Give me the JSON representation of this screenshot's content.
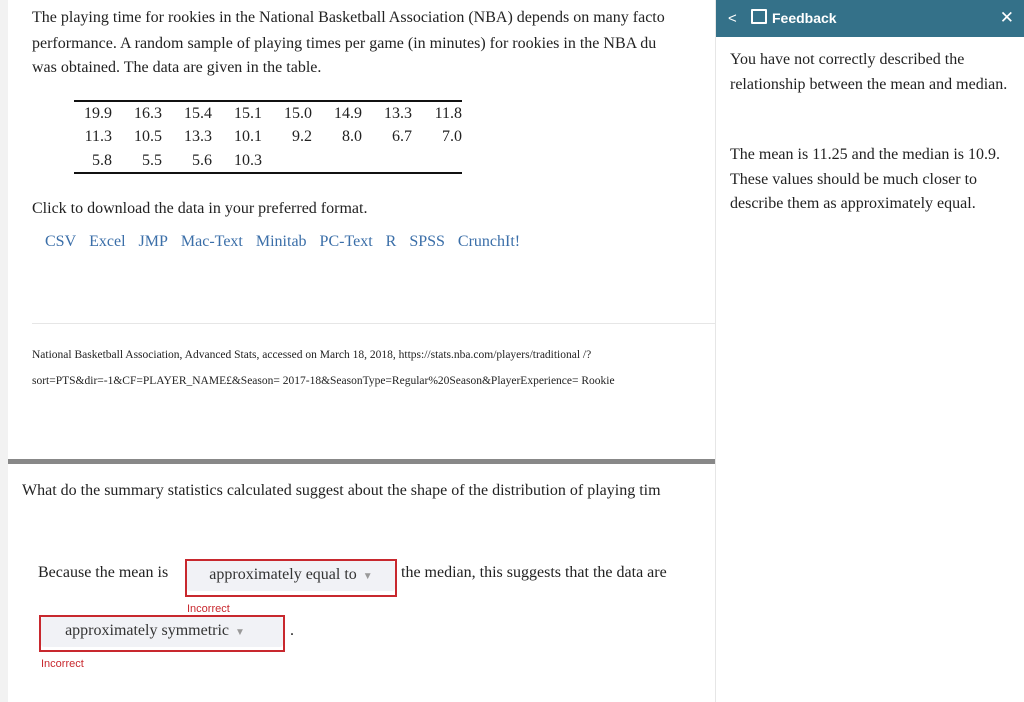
{
  "question": {
    "intro_lines": [
      "The playing time for rookies in the National Basketball Association (NBA) depends on many facto",
      "performance. A random sample of playing times per game (in minutes) for rookies in the NBA du",
      "was obtained. The data are given in the table."
    ],
    "table": [
      [
        "19.9",
        "16.3",
        "15.4",
        "15.1",
        "15.0",
        "14.9",
        "13.3",
        "11.8"
      ],
      [
        "11.3",
        "10.5",
        "13.3",
        "10.1",
        "9.2",
        "8.0",
        "6.7",
        "7.0"
      ],
      [
        "5.8",
        "5.5",
        "5.6",
        "10.3",
        "",
        "",
        "",
        ""
      ]
    ],
    "download_prompt": "Click to download the data in your preferred format.",
    "download_links": [
      "CSV",
      "Excel",
      "JMP",
      "Mac-Text",
      "Minitab",
      "PC-Text",
      "R",
      "SPSS",
      "CrunchIt!"
    ],
    "source_lines": [
      "National Basketball Association, Advanced Stats, accessed on March 18, 2018, https://stats.nba.com/players/traditional /?",
      "sort=PTS&dir=-1&CF=PLAYER_NAME£&Season= 2017-18&SeasonType=Regular%20Season&PlayerExperience= Rookie"
    ],
    "prompt": "What do the summary statistics calculated suggest about the shape of the distribution of playing tim",
    "sentence_start": "Because the mean is",
    "select1": "approximately equal to",
    "sentence_mid": "the median, this suggests that the data are",
    "select2": "approximately symmetric",
    "period": ".",
    "incorrect_label": "Incorrect"
  },
  "feedback": {
    "title": "Feedback",
    "back_icon": "chevron-left-icon",
    "close_icon": "close-icon",
    "header_color": "#347189",
    "error_color": "#c8282e",
    "p1": "You have not correctly described the relationship between the mean and median.",
    "p2": "The mean is 11.25 and the median is 10.9. These values should be much closer to describe them as approximately equal."
  }
}
